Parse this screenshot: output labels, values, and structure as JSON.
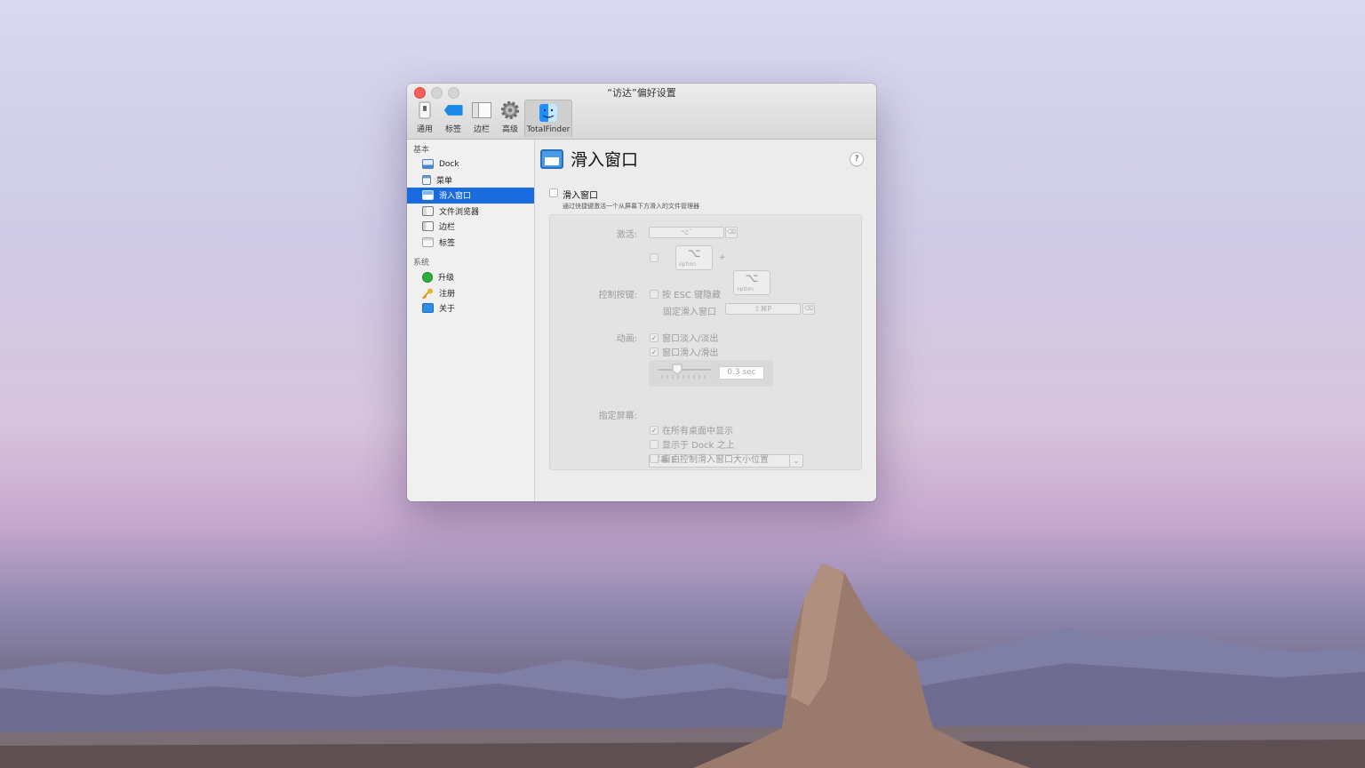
{
  "window": {
    "title": "“访达”偏好设置",
    "toolbar": [
      {
        "id": "general",
        "label": "通用",
        "icon": "switch-icon"
      },
      {
        "id": "tags",
        "label": "标签",
        "icon": "tag-icon"
      },
      {
        "id": "sidebar",
        "label": "边栏",
        "icon": "sidebar-icon"
      },
      {
        "id": "advanced",
        "label": "高级",
        "icon": "gear-icon"
      },
      {
        "id": "totalfinder",
        "label": "TotalFinder",
        "icon": "finder-icon",
        "selected": true
      }
    ]
  },
  "sidebar": {
    "basic_heading": "基本",
    "basic_items": [
      {
        "label": "Dock",
        "icon": "dock-icon"
      },
      {
        "label": "菜单",
        "icon": "menu-icon"
      },
      {
        "label": "滑入窗口",
        "icon": "visor-icon",
        "selected": true
      },
      {
        "label": "文件浏览器",
        "icon": "browser-icon"
      },
      {
        "label": "边栏",
        "icon": "sidebar-icon"
      },
      {
        "label": "标签",
        "icon": "tab-icon"
      }
    ],
    "system_heading": "系统",
    "system_items": [
      {
        "label": "升级",
        "icon": "upgrade-icon"
      },
      {
        "label": "注册",
        "icon": "key-icon"
      },
      {
        "label": "关于",
        "icon": "about-icon"
      }
    ]
  },
  "pane": {
    "title": "滑入窗口",
    "help": "?",
    "enable_label": "滑入窗口",
    "enable_desc": "通过快捷键激活一个从屏幕下方滑入的文件管理器",
    "activate_label": "激活:",
    "activate_hotkey": "⌥`",
    "modifier_key_symbol": "⌥",
    "modifier_key_name": "option",
    "plus": "+",
    "control_label": "控制按键:",
    "esc_hide": "按 ESC 键隐藏",
    "pin_label": "固定滑入窗口",
    "pin_hotkey": "⇧⌘P",
    "animation_label": "动画:",
    "fade_label": "窗口淡入/淡出",
    "slide_label": "窗口滑入/滑出",
    "duration": "0.3 sec",
    "screen_label": "指定屏幕:",
    "screen_value": "屏幕 1",
    "all_desktops": "在所有桌面中显示",
    "above_dock": "显示于 Dock 之上",
    "free_size": "自由控制滑入窗口大小位置",
    "clear_symbol": "⌫",
    "check_symbol": "✓",
    "chevron": "⌄",
    "states": {
      "enabled": false,
      "esc_hide": false,
      "fade": true,
      "slide": true,
      "all_desktops": true,
      "above_dock": false,
      "free_size": false,
      "option_modifier": false
    }
  },
  "colors": {
    "selection": "#1a6ae0",
    "close": "#fc5f57"
  }
}
